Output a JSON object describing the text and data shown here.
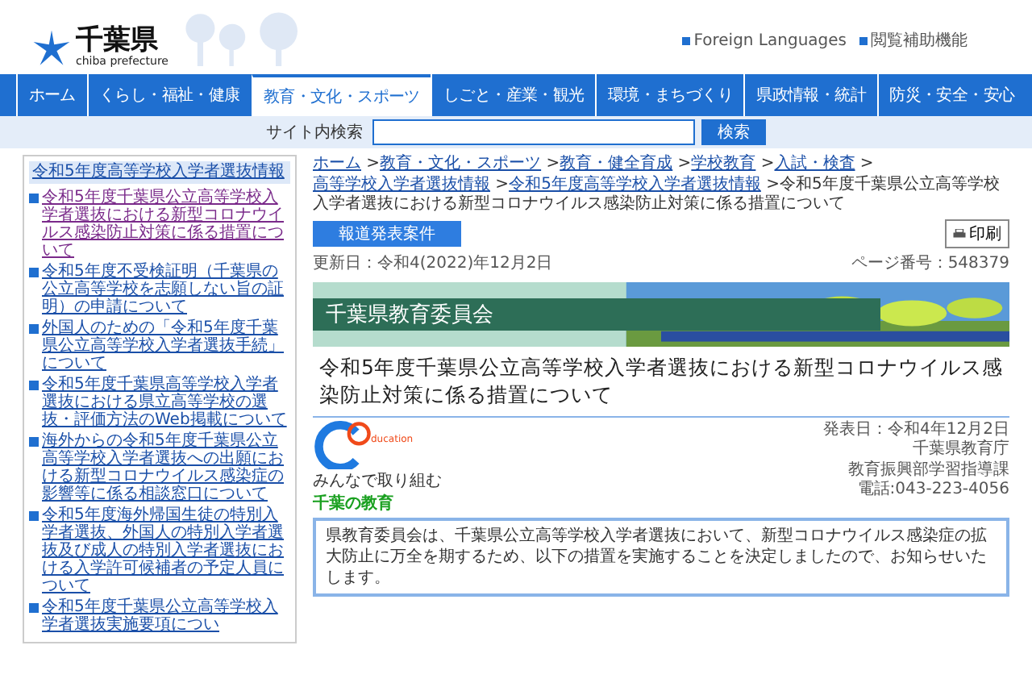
{
  "header": {
    "logo_title": "千葉県",
    "logo_subtitle": "chiba prefecture",
    "links": [
      "Foreign Languages",
      "閲覧補助機能"
    ]
  },
  "nav": [
    {
      "label": "ホーム",
      "selected": false
    },
    {
      "label": "くらし・福祉・健康",
      "selected": false
    },
    {
      "label": "教育・文化・スポーツ",
      "selected": true
    },
    {
      "label": "しごと・産業・観光",
      "selected": false
    },
    {
      "label": "環境・まちづくり",
      "selected": false
    },
    {
      "label": "県政情報・統計",
      "selected": false
    },
    {
      "label": "防災・安全・安心",
      "selected": false
    }
  ],
  "search": {
    "label": "サイト内検索",
    "button": "検索"
  },
  "sidebar": {
    "title": "令和5年度高等学校入学者選抜情報",
    "items": [
      "令和5年度千葉県公立高等学校入学者選抜における新型コロナウイルス感染防止対策に係る措置について",
      "令和5年度不受検証明（千葉県の公立高等学校を志願しない旨の証明）の申請について",
      "外国人のための「令和5年度千葉県公立高等学校入学者選抜手続」について",
      "令和5年度千葉県高等学校入学者選抜における県立高等学校の選抜・評価方法のWeb掲載について",
      "海外からの令和5年度千葉県公立高等学校入学者選抜への出願における新型コロナウイルス感染症の影響等に係る相談窓口について",
      "令和5年度海外帰国生徒の特別入学者選抜、外国人の特別入学者選抜及び成人の特別入学者選抜における入学許可候補者の予定人員について",
      "令和5年度千葉県公立高等学校入学者選抜実施要項につい"
    ]
  },
  "breadcrumb": {
    "separator": ">",
    "links": [
      "ホーム",
      "教育・文化・スポーツ",
      "教育・健全育成",
      "学校教育",
      "入試・検査",
      "高等学校入学者選抜情報",
      "令和5年度高等学校入学者選抜情報"
    ],
    "current": "令和5年度千葉県公立高等学校入学者選抜における新型コロナウイルス感染防止対策に係る措置について"
  },
  "tag": "報道発表案件",
  "print_button": "印刷",
  "updated": "更新日：令和4(2022)年12月2日",
  "page_number": "ページ番号：548379",
  "banner": {
    "title": "千葉県教育委員会"
  },
  "title": "令和5年度千葉県公立高等学校入学者選抜における新型コロナウイルス感染防止対策に係る措置について",
  "logo": {
    "mark": "ducation",
    "caption": "みんなで取り組む",
    "name": "千葉の教育"
  },
  "contact": [
    "発表日：令和4年12月2日",
    "千葉県教育庁",
    "教育振興部学習指導課",
    "電話:043-223-4056"
  ],
  "notice": "県教育委員会は、千葉県公立高等学校入学者選抜において、新型コロナウイルス感染症の拡大防止に万全を期するため、以下の措置を実施することを決定しましたので、お知らせいたします。"
}
